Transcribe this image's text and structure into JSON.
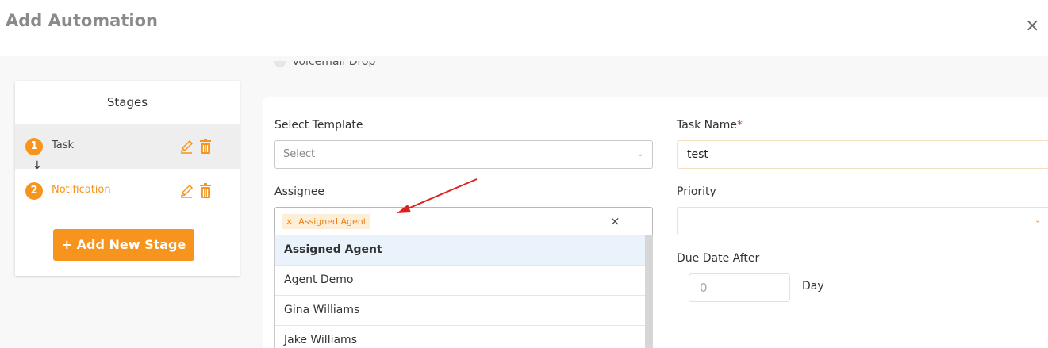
{
  "header": {
    "title": "Add Automation",
    "close_glyph": "×"
  },
  "stages": {
    "title": "Stages",
    "items": [
      {
        "number": "1",
        "label": "Task"
      },
      {
        "number": "2",
        "label": "Notification"
      }
    ],
    "add_button": "+ Add New Stage"
  },
  "voicemail_label": "Voicemail Drop",
  "form": {
    "template_label": "Select Template",
    "template_placeholder": "Select",
    "task_name_label": "Task Name",
    "task_name_required": "*",
    "task_name_value": "test",
    "assignee_label": "Assignee",
    "assignee_tag": "Assigned Agent",
    "tag_remove_glyph": "×",
    "clear_glyph": "×",
    "priority_label": "Priority",
    "due_date_label": "Due Date After",
    "due_date_placeholder": "0",
    "due_date_unit": "Day",
    "options": [
      "Assigned Agent",
      "Agent Demo",
      "Gina Williams",
      "Jake Williams"
    ]
  },
  "colors": {
    "accent": "#f7941d",
    "annotation_arrow": "#e02020",
    "highlight": "#eaf3fc"
  },
  "icons": {
    "close": "close-icon",
    "edit": "pencil-icon",
    "delete": "trash-icon",
    "chevron": "chevron-down-icon",
    "arrow": "arrow-down-icon"
  }
}
